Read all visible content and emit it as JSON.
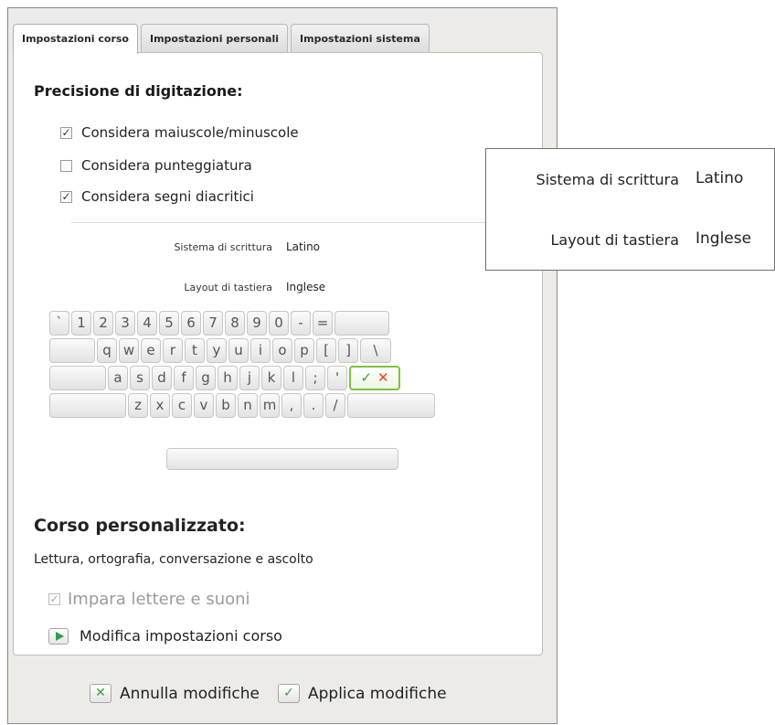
{
  "tabs": [
    {
      "label": "Impostazioni corso"
    },
    {
      "label": "Impostazioni personali"
    },
    {
      "label": "Impostazioni sistema"
    }
  ],
  "precision": {
    "title": "Precisione di digitazione:",
    "options": [
      {
        "label": "Considera maiuscole/minuscole",
        "checked": true
      },
      {
        "label": "Considera punteggiatura",
        "checked": false
      },
      {
        "label": "Considera segni diacritici",
        "checked": true
      }
    ]
  },
  "script": {
    "label": "Sistema di scrittura",
    "value": "Latino"
  },
  "layout": {
    "label": "Layout di tastiera",
    "value": "Inglese"
  },
  "keyboard": {
    "row1": [
      "`",
      "1",
      "2",
      "3",
      "4",
      "5",
      "6",
      "7",
      "8",
      "9",
      "0",
      "-",
      "="
    ],
    "row2": [
      "q",
      "w",
      "e",
      "r",
      "t",
      "y",
      "u",
      "i",
      "o",
      "p",
      "[",
      "]",
      "\\"
    ],
    "row3": [
      "a",
      "s",
      "d",
      "f",
      "g",
      "h",
      "j",
      "k",
      "l",
      ";",
      "'"
    ],
    "row4": [
      "z",
      "x",
      "c",
      "v",
      "b",
      "n",
      "m",
      ",",
      ".",
      "/"
    ],
    "ok_check": "✓",
    "ok_x": "✕"
  },
  "course": {
    "title": "Corso personalizzato:",
    "description": "Lettura, ortografia, conversazione e ascolto",
    "learn_label": "Impara lettere e suoni",
    "edit_label": "Modifica impostazioni corso"
  },
  "buttons": {
    "cancel_label": "Annulla modifiche",
    "apply_label": "Applica modifiche"
  },
  "callout": {
    "script_label": "Sistema di scrittura",
    "script_value": "Latino",
    "layout_label": "Layout di tastiera",
    "layout_value": "Inglese"
  }
}
